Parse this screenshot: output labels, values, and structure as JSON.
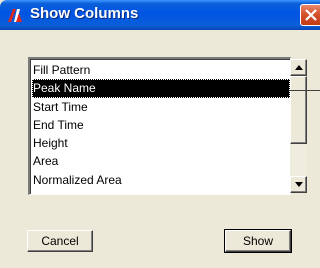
{
  "window": {
    "title": "Show Columns",
    "title_icon": "app-logo-icon",
    "close_icon": "close-icon"
  },
  "list": {
    "items": [
      {
        "label": "Fill Pattern",
        "selected": false
      },
      {
        "label": "Peak Name",
        "selected": true
      },
      {
        "label": "Start Time",
        "selected": false
      },
      {
        "label": "End Time",
        "selected": false
      },
      {
        "label": "Height",
        "selected": false
      },
      {
        "label": "Area",
        "selected": false
      },
      {
        "label": "Normalized Area",
        "selected": false
      }
    ]
  },
  "scrollbar": {
    "up_icon": "scroll-up-arrow-icon",
    "down_icon": "scroll-down-arrow-icon"
  },
  "buttons": {
    "cancel_label": "Cancel",
    "show_label": "Show"
  },
  "colors": {
    "titlebar": "#0054e3",
    "dialog_bg": "#ece9d8",
    "selection_bg": "#000000",
    "close_button": "#d6532e"
  }
}
